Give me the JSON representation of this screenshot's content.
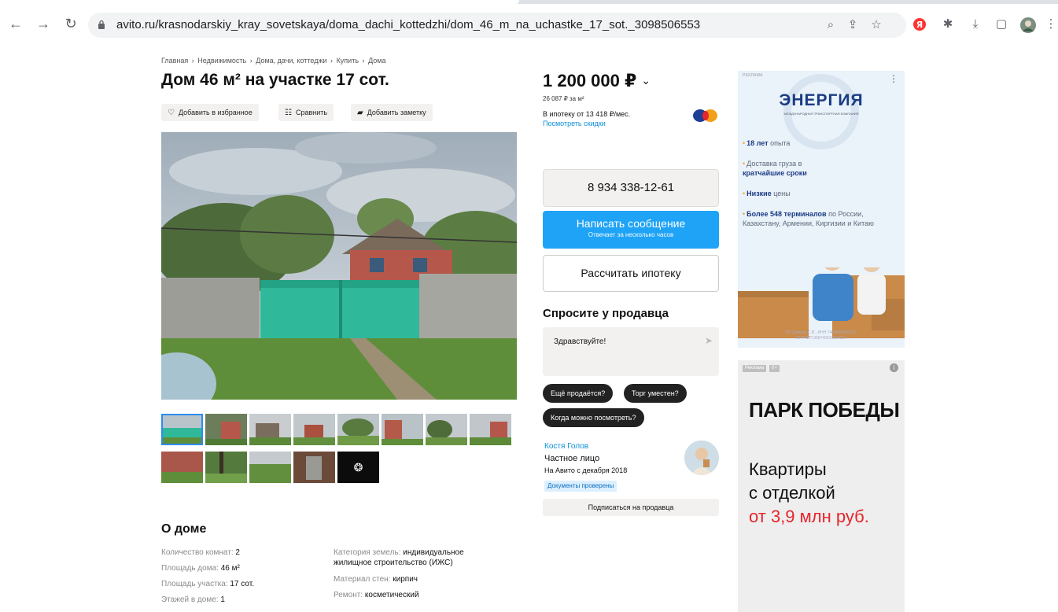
{
  "browser": {
    "url": "avito.ru/krasnodarskiy_kray_sovetskaya/doma_dachi_kottedzhi/dom_46_m_na_uchastke_17_sot._3098506553"
  },
  "breadcrumb": [
    "Главная",
    "Недвижимость",
    "Дома, дачи, коттеджи",
    "Купить",
    "Дома"
  ],
  "breadcrumb_sep": "›",
  "listing": {
    "title": "Дом 46 м² на участке 17 сот.",
    "actions": {
      "favorite": "Добавить в избранное",
      "compare": "Сравнить",
      "note": "Добавить заметку"
    }
  },
  "about": {
    "title": "О доме",
    "params_left": [
      {
        "label": "Количество комнат: ",
        "value": "2"
      },
      {
        "label": "Площадь дома: ",
        "value": "46 м²"
      },
      {
        "label": "Площадь участка: ",
        "value": "17 сот."
      },
      {
        "label": "Этажей в доме: ",
        "value": "1"
      }
    ],
    "land_category_label": "Категория земель: ",
    "land_category_value_1": "индивидуальное",
    "land_category_value_2": "жилищное строительство (ИЖС)",
    "walls_label": "Материал стен: ",
    "walls_value": "кирпич",
    "repair_label": "Ремонт: ",
    "repair_value": "косметический"
  },
  "price": {
    "value": "1 200 000 ₽",
    "chevron": "⌄",
    "per_meter": "26 087 ₽ за м²",
    "mortgage": "В ипотеку от 13 418 ₽/мес.",
    "discounts": "Посмотреть скидки"
  },
  "contact": {
    "phone": "8 934 338-12-61",
    "write": "Написать сообщение",
    "write_sub": "Отвечает за несколько часов",
    "mortgage_calc": "Рассчитать ипотеку"
  },
  "ask": {
    "title": "Спросите у продавца",
    "message": "Здравствуйте!",
    "chips": [
      "Ещё продаётся?",
      "Торг уместен?",
      "Когда можно посмотреть?"
    ]
  },
  "seller": {
    "name": "Костя Голов",
    "type": "Частное лицо",
    "since": "На Авито с декабря 2018",
    "verified": "Документы проверены",
    "subscribe": "Подписаться на продавца"
  },
  "ad_energy": {
    "tag": "РЕКЛАМА",
    "more": "⋮",
    "logo": "ЭНЕРГИЯ",
    "logo_sub": "МЕЖДУНАРОДНАЯ ТРАНСПОРТНАЯ КОМПАНИЯ",
    "p1_bold": "18 лет",
    "p1_rest": " опыта",
    "p2_rest": "Доставка груза в",
    "p2_bold": "кратчайшие сроки",
    "p3_bold": "Низкие",
    "p3_rest": " цены",
    "p4_bold": "Более 548 терминалов",
    "p4_rest": " по России, Казахстану, Армении, Киргизии и Китаю",
    "footer_1": "ИП Шевцов С.В., ИНН 7404050882103,",
    "footer_2": "ОГРНИП 309740432300016"
  },
  "ad_park": {
    "tag": "Реклама",
    "age": "0+",
    "info": "i",
    "logo": "ПАРК ПОБЕДЫ",
    "line1": "Квартиры",
    "line2": "с отделкой",
    "line3": "от 3,9 млн руб."
  },
  "colors": {
    "accent_blue": "#1fa3f6",
    "link_blue": "#0a8fd8",
    "ad_red": "#e5262c",
    "energy_navy": "#1b3b83"
  }
}
